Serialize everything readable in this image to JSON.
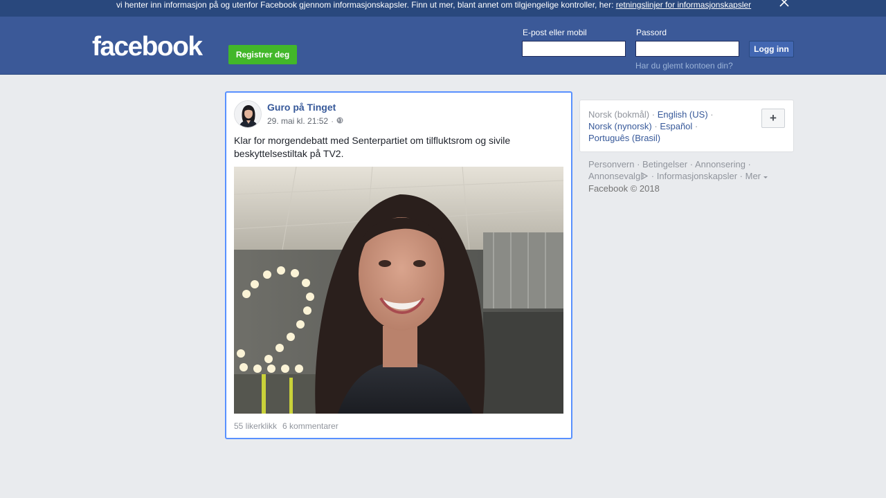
{
  "cookie_banner": {
    "text": "vi henter inn informasjon på og utenfor Facebook gjennom informasjonskapsler. Finn ut mer, blant annet om tilgjengelige kontroller, her: ",
    "link": "retningslinjer for informasjonskapsler"
  },
  "header": {
    "logo": "facebook",
    "register_label": "Registrer deg",
    "email_label": "E-post eller mobil",
    "email_value": "",
    "password_label": "Passord",
    "password_value": "",
    "login_label": "Logg inn",
    "forgot_label": "Har du glemt kontoen din?"
  },
  "post": {
    "author": "Guro på Tinget",
    "date": "29. mai kl. 21:52",
    "separator": "·",
    "text": "Klar for morgendebatt med Senterpartiet om tilfluktsrom og sivile beskyttelsestiltak på TV2.",
    "likes": "55 likerklikk",
    "comments": "6 kommentarer"
  },
  "languages": {
    "current": "Norsk (bokmål)",
    "options": [
      "English (US)",
      "Norsk (nynorsk)",
      "Español",
      "Português (Brasil)"
    ],
    "more_label": "+"
  },
  "footer": {
    "links": [
      "Personvern",
      "Betingelser",
      "Annonsering",
      "Annonsevalg",
      "Informasjonskapsler",
      "Mer"
    ],
    "copyright": "Facebook © 2018"
  },
  "colors": {
    "brand_blue": "#3b5998",
    "banner_blue": "#29487d",
    "register_green": "#42b72a",
    "link_blue": "#365899",
    "focus_blue": "#5890ff"
  },
  "icons": {
    "close": "close-icon",
    "audience": "globe-icon",
    "ad_choices": "adchoices-icon",
    "more_caret": "caret-down-icon"
  }
}
